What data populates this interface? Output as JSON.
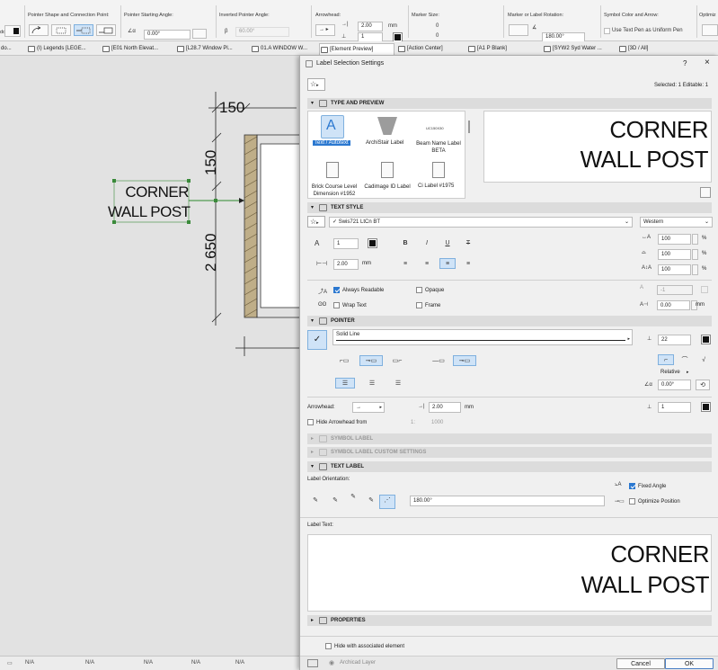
{
  "infobar": {
    "pointer_shape_label": "Pointer Shape and Connection Point:",
    "start_angle_label": "Pointer Starting Angle:",
    "start_angle_value": "0.00°",
    "inverted_angle_label": "Inverted Pointer Angle:",
    "inverted_angle_value": "60.00°",
    "arrowhead_label": "Arrowhead:",
    "arrow_size_value": "2.00",
    "arrow_size_unit": "mm",
    "arrow_pen_value": "1",
    "marker_size_label": "Marker Size:",
    "marker_size_a": "0",
    "marker_size_b": "0",
    "rotation_label": "Marker or Label Rotation:",
    "rotation_value": "180.00°",
    "symbol_color_label": "Symbol Color and Arrow:",
    "uniform_pen_label": "Use Text Pen as Uniform Pen",
    "optimize_label": "Optimiz",
    "left_cut": "do...",
    "beta_mark": "β"
  },
  "tabs": [
    {
      "label": "do..."
    },
    {
      "label": "(I) Legends [LEGE..."
    },
    {
      "label": "[E01 North Elevat..."
    },
    {
      "label": "[L28.7 Window Pl..."
    },
    {
      "label": "01.A WINDOW W..."
    },
    {
      "label": "[Element Preview]"
    },
    {
      "label": "[Action Center]"
    },
    {
      "label": "[A1 P Blank]"
    },
    {
      "label": "[SYW2 Syd Water ..."
    },
    {
      "label": "[3D / All]"
    }
  ],
  "canvas": {
    "dim_150_top": "150",
    "dim_150_side": "150",
    "dim_2650": "2 650",
    "label_line1": "CORNER",
    "label_line2": "WALL POST"
  },
  "status": {
    "na1": "N/A",
    "na2": "N/A",
    "na3": "N/A",
    "na4": "N/A",
    "na5": "N/A"
  },
  "dialog": {
    "title": "Label Selection Settings",
    "help": "?",
    "close": "×",
    "selected_info": "Selected: 1 Editable: 1",
    "type_preview": {
      "header": "TYPE AND PREVIEW",
      "items": [
        {
          "label": "Text / Autotext"
        },
        {
          "label": "ArchiStair Label"
        },
        {
          "label": "Beam Name Label BETA"
        },
        {
          "label": "Brick Course Level Dimension #1952"
        },
        {
          "label": "Cadimage ID Label"
        },
        {
          "label": "Ci Label #1975"
        }
      ],
      "beam_code": "UC150X30",
      "preview_line1": "CORNER",
      "preview_line2": "WALL POST"
    },
    "text_style": {
      "header": "TEXT STYLE",
      "font": "Swis721 LtCn BT",
      "encoding": "Western",
      "pen": "1",
      "size": "2.00",
      "size_unit": "mm",
      "width_pct": "100",
      "spacing_pct": "100",
      "slant_pct": "100",
      "pct": "%",
      "always_readable": "Always Readable",
      "opaque": "Opaque",
      "wrap_text": "Wrap Text",
      "frame": "Frame",
      "frame_pen": "-1",
      "frame_offset": "0.00",
      "frame_unit": "mm",
      "bold": "B",
      "italic": "I",
      "underline": "U",
      "strike": "T"
    },
    "pointer": {
      "header": "POINTER",
      "line_type": "Solid Line",
      "pen": "22",
      "relative": "Relative",
      "angle": "0.00°",
      "arrowhead_label": "Arrowhead:",
      "arrow_size": "2.00",
      "arrow_unit": "mm",
      "arrow_pen": "1",
      "hide_arrowhead": "Hide Arrowhead from",
      "scale_prefix": "1:",
      "scale_value": "1000"
    },
    "symbol_label": {
      "header": "SYMBOL LABEL"
    },
    "symbol_custom": {
      "header": "SYMBOL LABEL CUSTOM SETTINGS"
    },
    "text_label": {
      "header": "TEXT LABEL",
      "orientation_label": "Label Orientation:",
      "orientation_angle": "180.00°",
      "fixed_angle": "Fixed Angle",
      "optimize_position": "Optimize Position",
      "label_text_caption": "Label Text:",
      "text_line1": "CORNER",
      "text_line2": "WALL POST"
    },
    "properties": {
      "header": "PROPERTIES"
    },
    "hide_with_element": "Hide with associated element",
    "layer": "Archicad Layer",
    "cancel": "Cancel",
    "ok": "OK"
  },
  "colors": {
    "accent": "#2b78d0",
    "selection": "#cfe3f7",
    "dialog_bg": "#f0f0f0",
    "canvas_bg": "#e2e2e2",
    "wall_hatch": "#8a7a5a",
    "label_green": "#3a8a3a"
  },
  "icons": [
    "star-icon",
    "chevron-down-icon",
    "help-icon",
    "close-icon",
    "pencil-icon",
    "layer-eye-icon"
  ]
}
